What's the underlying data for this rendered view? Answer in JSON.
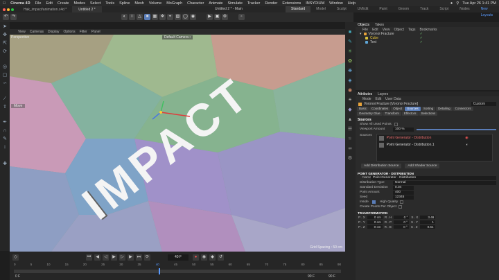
{
  "menubar": {
    "app": "Cinema 4D",
    "items": [
      "File",
      "Edit",
      "Create",
      "Modes",
      "Select",
      "Tools",
      "Spline",
      "Mesh",
      "Volume",
      "MoGraph",
      "Character",
      "Animate",
      "Simulate",
      "Tracker",
      "Render",
      "Extensions",
      "INSYDIUM",
      "Window",
      "Help"
    ],
    "clock": "Tue Apr 26  1:41 PM"
  },
  "titlebar": {
    "tabs": [
      "Hak_impact/animation.c4d *",
      "Untitled 2 *"
    ],
    "title": "Untitled 2 * - Main",
    "layouts": [
      "Standard",
      "Model",
      "Sculpt",
      "UVEdit",
      "Paint",
      "Groom",
      "Track",
      "Script",
      "Nodes"
    ],
    "new_layouts": "New Layouts"
  },
  "viewport_menu": [
    "View",
    "Cameras",
    "Display",
    "Options",
    "Filter",
    "Panel"
  ],
  "viewport": {
    "perspective": "Perspective",
    "camera": "Default Camera •",
    "grid_spacing": "Grid Spacing : 50 cm",
    "move_label": "Move",
    "text": "IMPACT"
  },
  "timeline": {
    "frame": "40 F",
    "ruler": [
      "0",
      "5",
      "10",
      "15",
      "20",
      "25",
      "30",
      "35",
      "40",
      "45",
      "50",
      "55",
      "60",
      "65",
      "70",
      "75",
      "80",
      "85",
      "90"
    ],
    "start": "0 F",
    "end": "90 F",
    "end2": "90 F"
  },
  "objects": {
    "tabs": [
      "Objects",
      "Takes"
    ],
    "menu": [
      "File",
      "Edit",
      "View",
      "Object",
      "Tags",
      "Bookmarks"
    ],
    "rows": [
      {
        "name": "Voronoi Fracture",
        "color": "#e8a33b"
      },
      {
        "name": "Cube",
        "color": "#d8c13c"
      },
      {
        "name": "Text",
        "color": "#5fa6d6"
      }
    ]
  },
  "attributes": {
    "tabs": [
      "Attributes",
      "Layers"
    ],
    "menu": [
      "Mode",
      "Edit",
      "User Data"
    ],
    "object_title": "Voronoi Fracture [Voronoi Fracture]",
    "custom": "Custom",
    "buttons": [
      "Basic",
      "Coordinates",
      "Object",
      "Sources",
      "Sorting",
      "Detailing",
      "Connectors",
      "Geometry Glue",
      "Transform",
      "Effectors",
      "Selections"
    ],
    "active_button": "Sources",
    "sources_title": "Sources",
    "show_all": "Show All Used Points",
    "viewport_amount_label": "Viewport Amount",
    "viewport_amount": "100 %",
    "sources_label": "Sources",
    "source_items": [
      "Point Generator - Distribution",
      "Point Generator - Distribution.1"
    ],
    "add_distribution": "Add Distribution Source",
    "add_shader": "Add Shader Source",
    "pg_section": "POINT GENERATOR - DISTRIBUTION",
    "name_label": "Name",
    "name_value": "Point Generator - Distribution",
    "dist_type_label": "Distribution Type",
    "dist_type": "Normal",
    "std_dev_label": "Standard Deviation",
    "std_dev": "0.04",
    "point_amount_label": "Point Amount",
    "point_amount": "400",
    "seed_label": "Seed",
    "seed": "12345",
    "inside_label": "Inside",
    "hq_label": "High Quality",
    "create_points_label": "Create Points Per Object",
    "transform_section": "TRANSFORMATION",
    "transform": [
      [
        "P . X",
        "0 cm",
        "R . H",
        "0 °",
        "S . X",
        "3.46"
      ],
      [
        "P . Y",
        "0 cm",
        "R . P",
        "0 °",
        "S . Y",
        "1"
      ],
      [
        "P . Z",
        "0 cm",
        "R . B",
        "0 °",
        "S . Z",
        "0.61"
      ]
    ]
  }
}
